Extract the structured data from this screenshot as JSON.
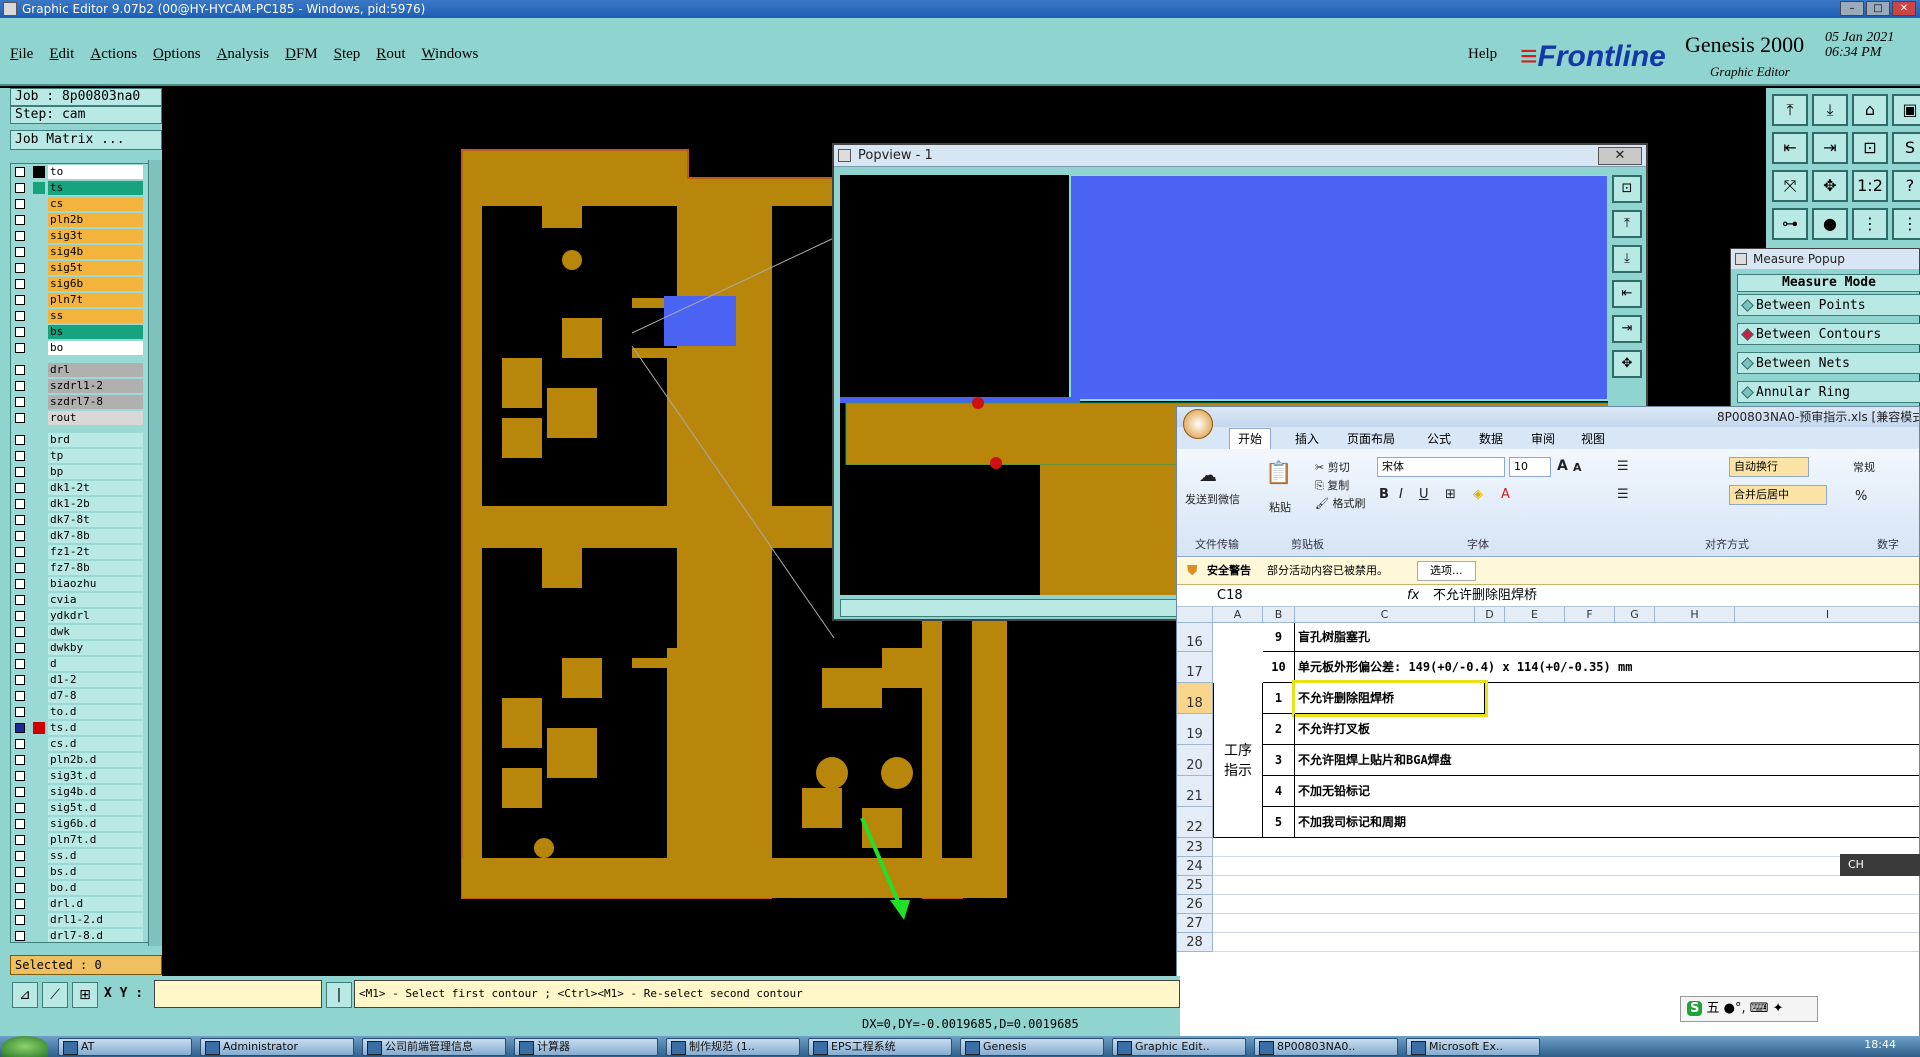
{
  "window": {
    "title": "Graphic Editor 9.07b2 (00@HY-HYCAM-PC185 - Windows, pid:5976)"
  },
  "menu": {
    "items": [
      "File",
      "Edit",
      "Actions",
      "Options",
      "Analysis",
      "DFM",
      "Step",
      "Rout",
      "Windows"
    ],
    "help": "Help"
  },
  "brand": {
    "logo": "Frontline",
    "product": "Genesis 2000",
    "subtitle": "Graphic Editor",
    "date": "05 Jan 2021",
    "time": "06:34 PM"
  },
  "job": {
    "job_label": "Job : 8p00803na0",
    "step_label": "Step: cam",
    "matrix_button": "Job Matrix ..."
  },
  "layers": [
    {
      "name": "to",
      "color": "#ffffff",
      "sw": "#000000"
    },
    {
      "name": "ts",
      "color": "#17a37e",
      "sw": "#17a37e"
    },
    {
      "name": "cs",
      "color": "#f2b43c",
      "sw": ""
    },
    {
      "name": "pln2b",
      "color": "#f2b43c",
      "sw": ""
    },
    {
      "name": "sig3t",
      "color": "#f2b43c",
      "sw": ""
    },
    {
      "name": "sig4b",
      "color": "#f2b43c",
      "sw": ""
    },
    {
      "name": "sig5t",
      "color": "#f2b43c",
      "sw": ""
    },
    {
      "name": "sig6b",
      "color": "#f2b43c",
      "sw": ""
    },
    {
      "name": "pln7t",
      "color": "#f2b43c",
      "sw": ""
    },
    {
      "name": "ss",
      "color": "#f2b43c",
      "sw": ""
    },
    {
      "name": "bs",
      "color": "#17a37e",
      "sw": ""
    },
    {
      "name": "bo",
      "color": "#ffffff",
      "sw": ""
    },
    {
      "gap": true
    },
    {
      "name": "drl",
      "color": "#b0b0b0",
      "sw": ""
    },
    {
      "name": "szdrl1-2",
      "color": "#b0b0b0",
      "sw": ""
    },
    {
      "name": "szdrl7-8",
      "color": "#b0b0b0",
      "sw": ""
    },
    {
      "name": "rout",
      "color": "#d8d8d8",
      "sw": ""
    },
    {
      "gap": true
    },
    {
      "name": "brd",
      "color": "#b8e9e5",
      "sw": ""
    },
    {
      "name": "tp",
      "color": "#b8e9e5",
      "sw": ""
    },
    {
      "name": "bp",
      "color": "#b8e9e5",
      "sw": ""
    },
    {
      "name": "dk1-2t",
      "color": "#b8e9e5",
      "sw": ""
    },
    {
      "name": "dk1-2b",
      "color": "#b8e9e5",
      "sw": ""
    },
    {
      "name": "dk7-8t",
      "color": "#b8e9e5",
      "sw": ""
    },
    {
      "name": "dk7-8b",
      "color": "#b8e9e5",
      "sw": ""
    },
    {
      "name": "fz1-2t",
      "color": "#b8e9e5",
      "sw": ""
    },
    {
      "name": "fz7-8b",
      "color": "#b8e9e5",
      "sw": ""
    },
    {
      "name": "biaozhu",
      "color": "#b8e9e5",
      "sw": ""
    },
    {
      "name": "cvia",
      "color": "#b8e9e5",
      "sw": ""
    },
    {
      "name": "ydkdrl",
      "color": "#b8e9e5",
      "sw": ""
    },
    {
      "name": "dwk",
      "color": "#b8e9e5",
      "sw": ""
    },
    {
      "name": "dwkby",
      "color": "#b8e9e5",
      "sw": ""
    },
    {
      "name": "d",
      "color": "#b8e9e5",
      "sw": ""
    },
    {
      "name": "d1-2",
      "color": "#b8e9e5",
      "sw": ""
    },
    {
      "name": "d7-8",
      "color": "#b8e9e5",
      "sw": ""
    },
    {
      "name": "to.d",
      "color": "#b8e9e5",
      "sw": ""
    },
    {
      "name": "ts.d",
      "color": "#b8e9e5",
      "sw": "#d00000",
      "sel": true
    },
    {
      "name": "cs.d",
      "color": "#b8e9e5",
      "sw": ""
    },
    {
      "name": "pln2b.d",
      "color": "#b8e9e5",
      "sw": ""
    },
    {
      "name": "sig3t.d",
      "color": "#b8e9e5",
      "sw": ""
    },
    {
      "name": "sig4b.d",
      "color": "#b8e9e5",
      "sw": ""
    },
    {
      "name": "sig5t.d",
      "color": "#b8e9e5",
      "sw": ""
    },
    {
      "name": "sig6b.d",
      "color": "#b8e9e5",
      "sw": ""
    },
    {
      "name": "pln7t.d",
      "color": "#b8e9e5",
      "sw": ""
    },
    {
      "name": "ss.d",
      "color": "#b8e9e5",
      "sw": ""
    },
    {
      "name": "bs.d",
      "color": "#b8e9e5",
      "sw": ""
    },
    {
      "name": "bo.d",
      "color": "#b8e9e5",
      "sw": ""
    },
    {
      "name": "drl.d",
      "color": "#b8e9e5",
      "sw": ""
    },
    {
      "name": "drl1-2.d",
      "color": "#b8e9e5",
      "sw": ""
    },
    {
      "name": "drl7-8.d",
      "color": "#b8e9e5",
      "sw": ""
    }
  ],
  "selected_label": "Selected : 0",
  "command": {
    "xy_label": "X Y :",
    "xy_value": "",
    "prompt": "<M1> - Select first contour ; <Ctrl><M1> - Re-select second contour"
  },
  "status": {
    "measure": "DX=0,DY=-0.0019685,D=0.0019685"
  },
  "popview": {
    "title": "Popview - 1",
    "close": "✕"
  },
  "measure_popup": {
    "title": "Measure Popup",
    "mode": "Measure Mode",
    "options": [
      {
        "label": "Between Points",
        "selected": false
      },
      {
        "label": "Between Contours",
        "selected": true
      },
      {
        "label": "Between Nets",
        "selected": false
      },
      {
        "label": "Annular Ring",
        "selected": false
      }
    ]
  },
  "excel": {
    "filename": "8P00803NA0-预审指示.xls [兼容模式]",
    "tabs": [
      "开始",
      "插入",
      "页面布局",
      "公式",
      "数据",
      "审阅",
      "视图"
    ],
    "ribbon": {
      "send_wechat": "发送到微信",
      "file_transfer": "文件传输",
      "paste": "粘贴",
      "cut": "剪切",
      "copy": "复制",
      "format_painter": "格式刷",
      "clipboard": "剪贴板",
      "font_name": "宋体",
      "font_size": "10",
      "font_group": "字体",
      "wrap_text": "自动换行",
      "merge_center": "合并后居中",
      "align_group": "对齐方式",
      "number_format": "常规",
      "number_group": "数字",
      "bold": "B",
      "italic": "I",
      "underline": "U",
      "font_grow": "A",
      "font_shrink": "A"
    },
    "security": {
      "title": "安全警告",
      "message": "部分活动内容已被禁用。",
      "options_button": "选项..."
    },
    "namebox": "C18",
    "fx": "fx",
    "formula": "不允许删除阻焊桥",
    "columns": [
      "A",
      "B",
      "C",
      "D",
      "E",
      "F",
      "G",
      "H",
      "I"
    ],
    "rows": [
      {
        "row": "16",
        "num": "9",
        "text": "盲孔树脂塞孔"
      },
      {
        "row": "17",
        "num": "10",
        "text": "单元板外形偏公差: 149(+0/-0.4) x 114(+0/-0.35) mm"
      },
      {
        "row": "18",
        "num": "1",
        "text": "不允许删除阻焊桥"
      },
      {
        "row": "19",
        "num": "2",
        "text": "不允许打叉板"
      },
      {
        "row": "20",
        "num": "3",
        "text": "不允许阻焊上贴片和BGA焊盘"
      },
      {
        "row": "21",
        "num": "4",
        "text": "不加无铅标记"
      },
      {
        "row": "22",
        "num": "5",
        "text": "不加我司标记和周期"
      }
    ],
    "merged_label": "工序\n指示",
    "empty_rows": [
      "23",
      "24",
      "25",
      "26",
      "27",
      "28"
    ]
  },
  "ime": {
    "text": "五",
    "ch": "CH"
  },
  "taskbar": {
    "items": [
      "AT",
      "Administrator",
      "公司前端管理信息",
      "计算器",
      "制作规范 (1..",
      "EPS工程系统",
      "Genesis",
      "Graphic Edit..",
      "8P00803NA0..",
      "Microsoft Ex.."
    ],
    "clock": "18:44"
  }
}
